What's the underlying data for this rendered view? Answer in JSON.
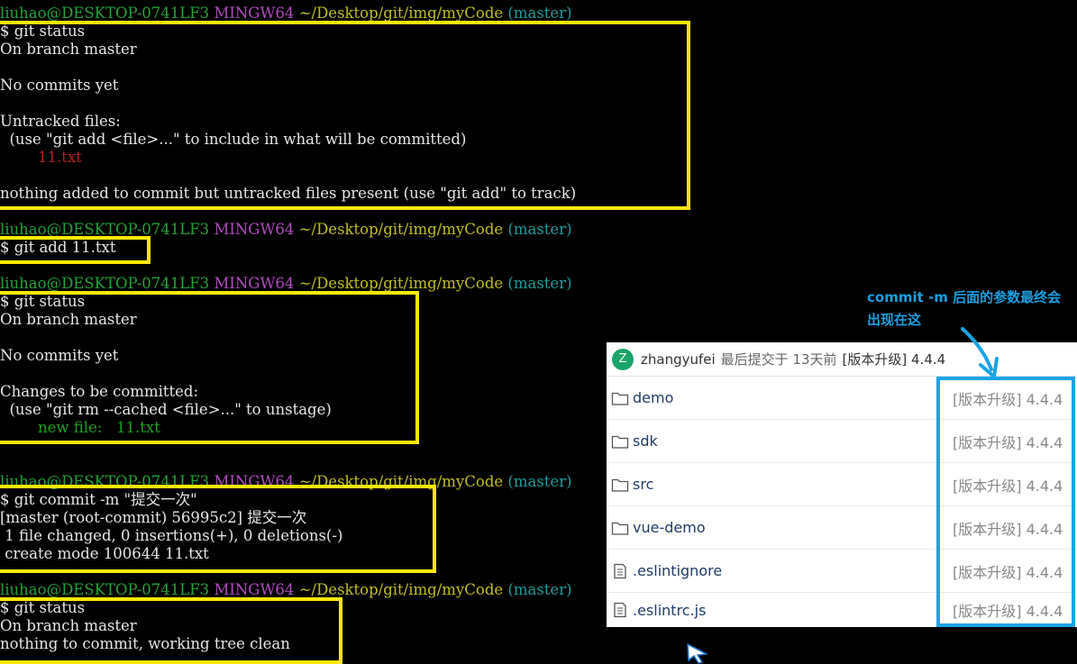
{
  "prompt": {
    "user_host": "liuhao@DESKTOP-0741LF3",
    "system": "MINGW64",
    "path": "~/Desktop/git/img/myCode",
    "branch": "(master)"
  },
  "block1": {
    "command": "$ git status",
    "l1": "On branch master",
    "l2": "No commits yet",
    "l3": "Untracked files:",
    "l4": "  (use \"git add <file>...\" to include in what will be committed)",
    "l5": "        11.txt",
    "l6": "nothing added to commit but untracked files present (use \"git add\" to track)"
  },
  "block2": {
    "command": "$ git add 11.txt"
  },
  "block3": {
    "command": "$ git status",
    "l1": "On branch master",
    "l2": "No commits yet",
    "l3": "Changes to be committed:",
    "l4": "  (use \"git rm --cached <file>...\" to unstage)",
    "l5": "        new file:   11.txt"
  },
  "block4": {
    "command": "$ git commit -m \"提交一次\"",
    "l1": "[master (root-commit) 56995c2] 提交一次",
    "l2": " 1 file changed, 0 insertions(+), 0 deletions(-)",
    "l3": " create mode 100644 11.txt"
  },
  "block5": {
    "command": "$ git status",
    "l1": "On branch master",
    "l2": "nothing to commit, working tree clean"
  },
  "annotation": {
    "text": "commit -m 后面的参数最终会出现在这"
  },
  "repo": {
    "avatar_letter": "Z",
    "author": "zhangyufei",
    "last_commit_text": "最后提交于 13天前",
    "last_commit_message": "[版本升级] 4.4.4",
    "files": [
      {
        "name": "demo",
        "type": "folder-icon",
        "message": "[版本升级] 4.4.4"
      },
      {
        "name": "sdk",
        "type": "folder-icon",
        "message": "[版本升级] 4.4.4"
      },
      {
        "name": "src",
        "type": "folder-icon",
        "message": "[版本升级] 4.4.4"
      },
      {
        "name": "vue-demo",
        "type": "folder-icon",
        "message": "[版本升级] 4.4.4"
      },
      {
        "name": ".eslintignore",
        "type": "file-icon",
        "message": "[版本升级] 4.4.4"
      },
      {
        "name": ".eslintrc.js",
        "type": "file-icon",
        "message": "[版本升级] 4.4.4"
      }
    ]
  },
  "colors": {
    "highlight_yellow": "#ffea00",
    "highlight_blue": "#1ba4e6",
    "prompt_user": "#22a336",
    "prompt_mingw": "#b14cc0",
    "prompt_path": "#bfbf20",
    "prompt_branch": "#1f9c9c"
  }
}
